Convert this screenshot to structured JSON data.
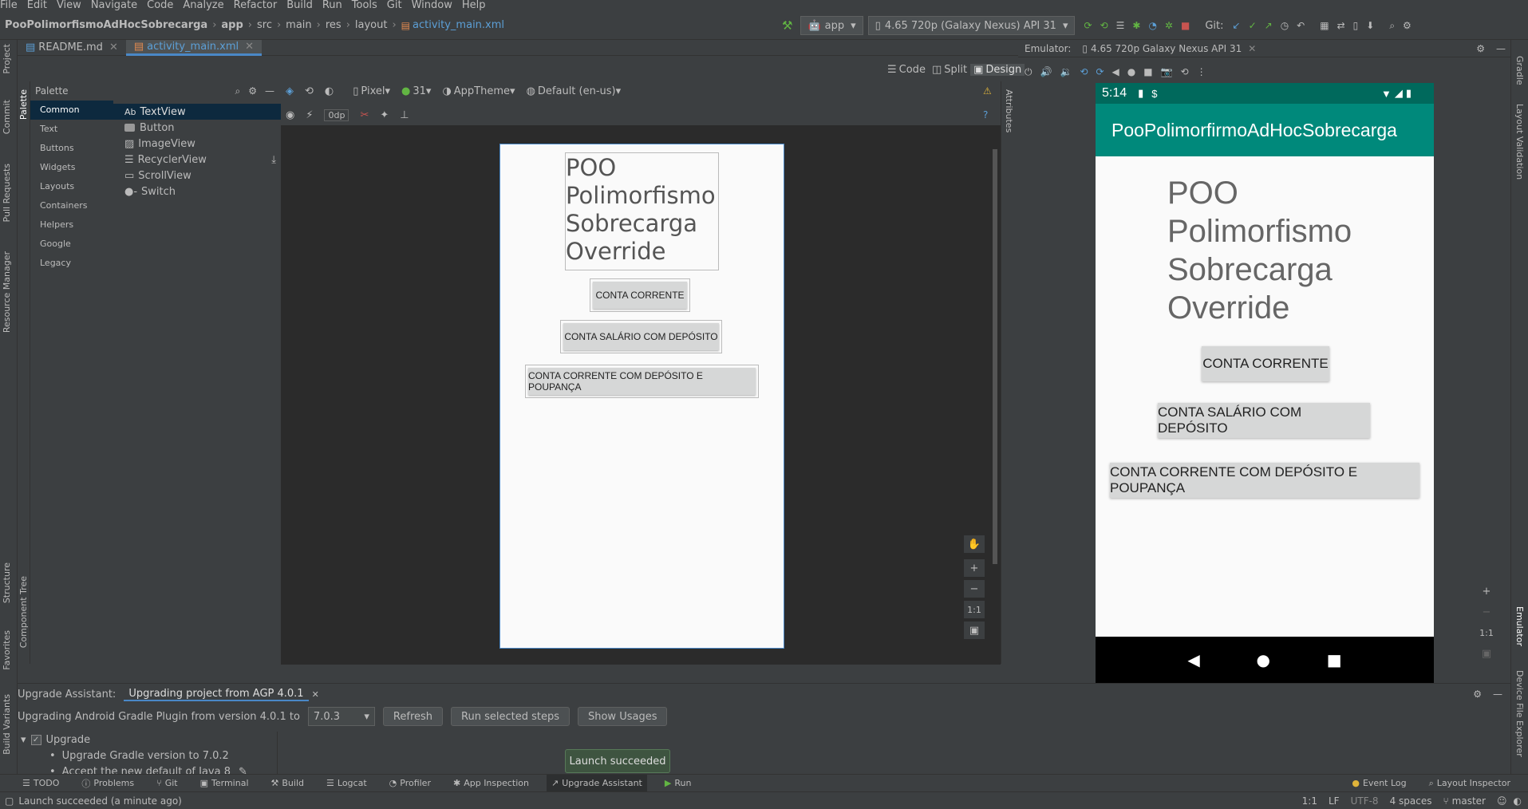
{
  "menu": [
    "File",
    "Edit",
    "View",
    "Navigate",
    "Code",
    "Analyze",
    "Refactor",
    "Build",
    "Run",
    "Tools",
    "Git",
    "Window",
    "Help"
  ],
  "breadcrumb": {
    "project": "PooPolimorfismoAdHocSobrecarga",
    "parts": [
      "app",
      "src",
      "main",
      "res",
      "layout"
    ],
    "file": "activity_main.xml"
  },
  "toolbar": {
    "config": "app",
    "device": "4.65  720p (Galaxy Nexus) API 31",
    "git_label": "Git:"
  },
  "editor_tabs": [
    {
      "label": "README.md",
      "active": false
    },
    {
      "label": "activity_main.xml",
      "active": true
    }
  ],
  "view_modes": [
    "Code",
    "Split",
    "Design"
  ],
  "palette": {
    "title": "Palette",
    "categories": [
      "Common",
      "Text",
      "Buttons",
      "Widgets",
      "Layouts",
      "Containers",
      "Helpers",
      "Google",
      "Legacy"
    ],
    "items": [
      {
        "icon": "Ab",
        "label": "TextView"
      },
      {
        "icon": "btn",
        "label": "Button"
      },
      {
        "icon": "img",
        "label": "ImageView"
      },
      {
        "icon": "list",
        "label": "RecyclerView"
      },
      {
        "icon": "scroll",
        "label": "ScrollView"
      },
      {
        "icon": "switch",
        "label": "Switch"
      }
    ]
  },
  "design_toolbar": {
    "device": "Pixel",
    "api": "31",
    "theme": "AppTheme",
    "locale": "Default (en-us)",
    "margin": "0dp"
  },
  "layout": {
    "title_lines": [
      "POO",
      "Polimorfismo",
      "Sobrecarga",
      "Override"
    ],
    "buttons": [
      "CONTA CORRENTE",
      "CONTA SALÁRIO COM DEPÓSITO",
      "CONTA CORRENTE COM DEPÓSITO E POUPANÇA"
    ]
  },
  "emulator": {
    "label": "Emulator:",
    "tab": "4.65 720p Galaxy Nexus API 31",
    "time": "5:14",
    "app_title": "PooPolimorfirmoAdHocSobrecarga"
  },
  "zoom": {
    "ratio": "1:1"
  },
  "left_stripe": [
    "Project",
    "Commit",
    "Pull Requests",
    "Resource Manager",
    "Structure",
    "Favorites",
    "Build Variants"
  ],
  "inner_stripe": [
    "Palette",
    "Component Tree"
  ],
  "attributes_label": "Attributes",
  "right_stripe": [
    "Gradle",
    "Layout Validation",
    "Emulator",
    "Device File Explorer"
  ],
  "upgrade": {
    "title": "Upgrade Assistant:",
    "tab": "Upgrading project from AGP 4.0.1",
    "desc": "Upgrading Android Gradle Plugin from version 4.0.1 to",
    "version": "7.0.3",
    "refresh": "Refresh",
    "run_steps": "Run selected steps",
    "show_usages": "Show Usages",
    "tree_root": "Upgrade",
    "steps": [
      "Upgrade Gradle version to 7.0.2",
      "Accept the new default of Java 8"
    ]
  },
  "toast": "Launch succeeded",
  "tool_windows": [
    "TODO",
    "Problems",
    "Git",
    "Terminal",
    "Build",
    "Logcat",
    "Profiler",
    "App Inspection",
    "Upgrade Assistant",
    "Run"
  ],
  "tool_windows_right": [
    "Event Log",
    "Layout Inspector"
  ],
  "status": {
    "message": "Launch succeeded (a minute ago)",
    "pos": "1:1",
    "lf": "LF",
    "enc": "UTF-8",
    "indent": "4 spaces",
    "branch": "master"
  },
  "colors": {
    "accent": "#4a88c7",
    "app_primary": "#00897b",
    "app_dark": "#00695c"
  }
}
